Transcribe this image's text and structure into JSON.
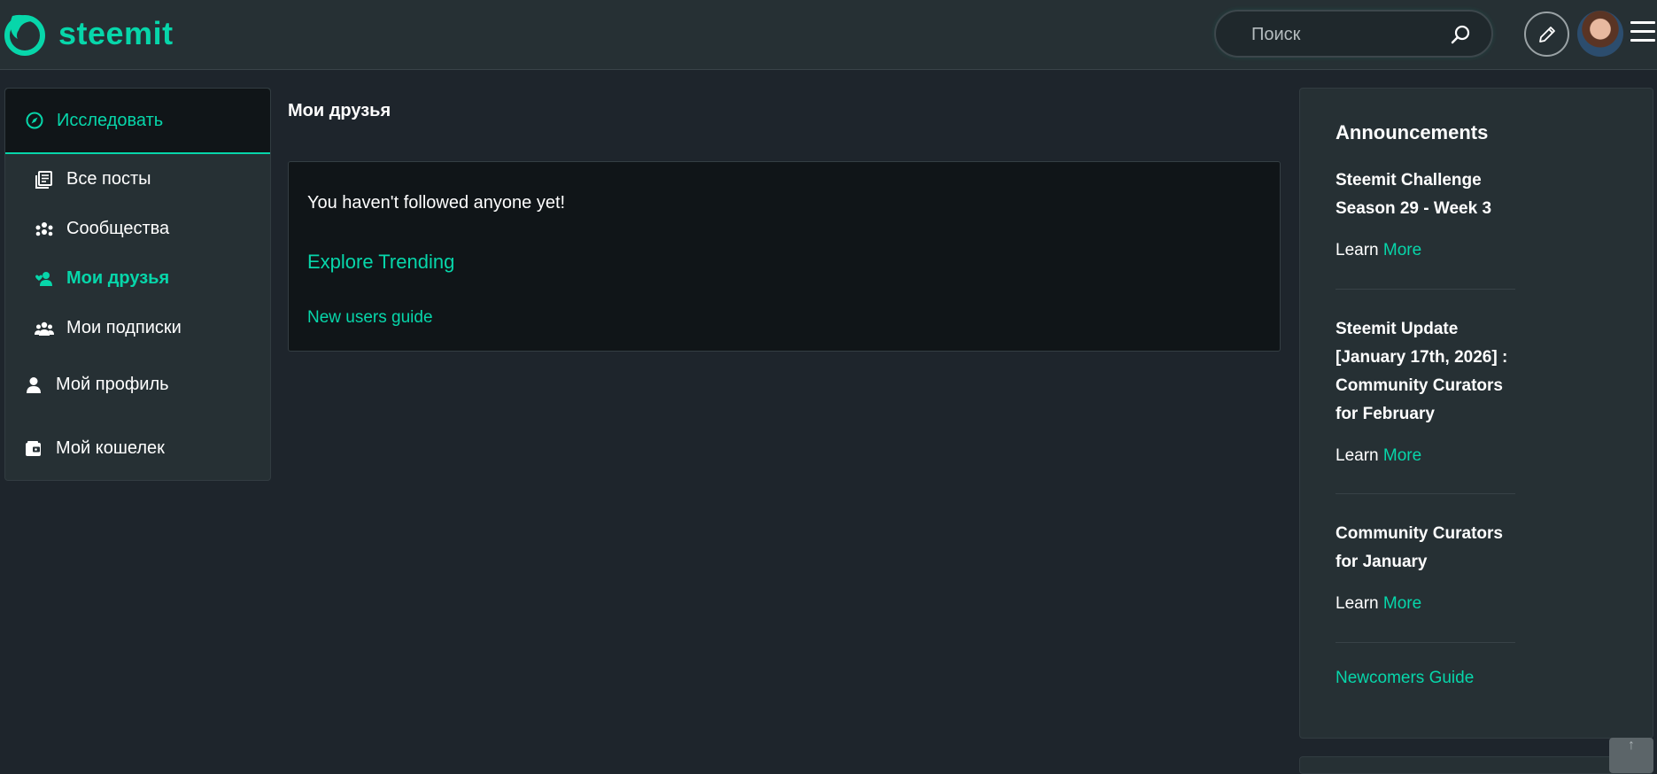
{
  "header": {
    "logo_text": "steemit",
    "search_placeholder": "Поиск"
  },
  "sidebar": {
    "explore_label": "Исследовать",
    "items": [
      {
        "label": "Все посты",
        "icon": "posts-icon"
      },
      {
        "label": "Сообщества",
        "icon": "communities-icon"
      },
      {
        "label": "Мои друзья",
        "icon": "friends-icon",
        "active": true
      },
      {
        "label": "Мои подписки",
        "icon": "subscriptions-icon"
      },
      {
        "label": "Мой профиль",
        "icon": "profile-icon"
      },
      {
        "label": "Мой кошелек",
        "icon": "wallet-icon"
      }
    ]
  },
  "main": {
    "title": "Мои друзья",
    "message": "You haven't followed anyone yet!",
    "explore_link": "Explore Trending",
    "guide_link": "New users guide"
  },
  "announcements": {
    "title": "Announcements",
    "items": [
      {
        "title": "Steemit Challenge Season 29 - Week 3",
        "learn": "Learn",
        "more": "More"
      },
      {
        "title": "Steemit Update [January 17th, 2026] : Community Curators for February",
        "learn": "Learn",
        "more": "More"
      },
      {
        "title": "Community Curators for January",
        "learn": "Learn",
        "more": "More"
      }
    ],
    "newcomers_link": "Newcomers Guide"
  },
  "scroll_top_glyph": "↑",
  "colors": {
    "accent": "#07d6aa",
    "background": "#1e252c",
    "panel": "#263034",
    "card": "#101518"
  }
}
